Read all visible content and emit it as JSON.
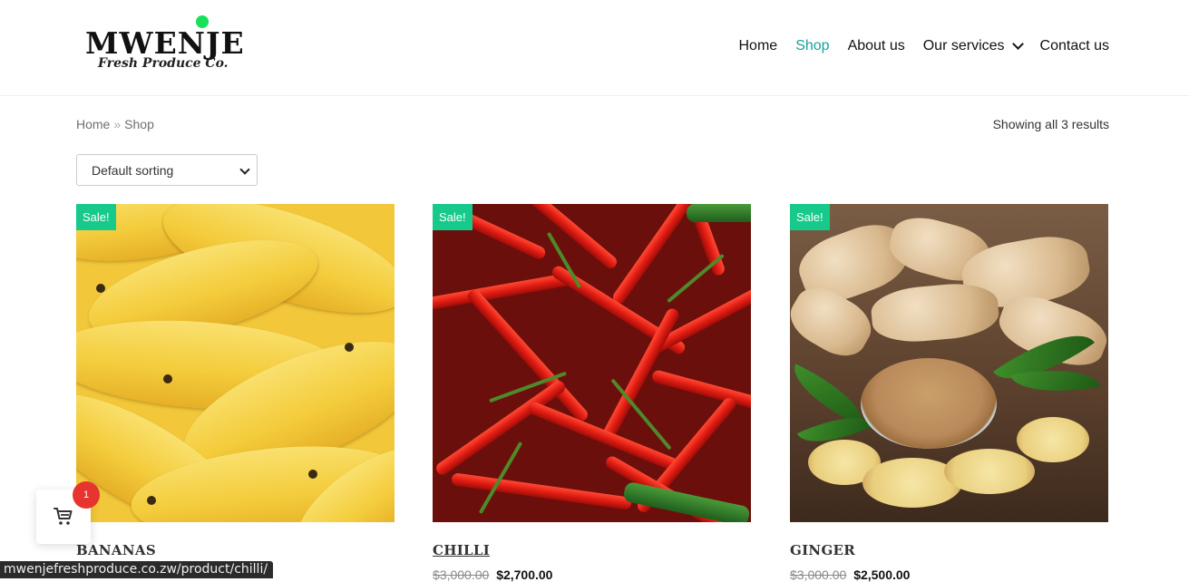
{
  "brand": {
    "name": "MWENJE",
    "tagline": "Fresh Produce Co."
  },
  "nav": [
    {
      "label": "Home",
      "active": false
    },
    {
      "label": "Shop",
      "active": true
    },
    {
      "label": "About us",
      "active": false
    },
    {
      "label": "Our services",
      "active": false,
      "has_dropdown": true
    },
    {
      "label": "Contact us",
      "active": false
    }
  ],
  "breadcrumb": {
    "home": "Home",
    "separator": "»",
    "current": "Shop"
  },
  "result_count": "Showing all 3 results",
  "sorting": {
    "selected": "Default sorting"
  },
  "products": [
    {
      "badge": "Sale!",
      "title": "BANANAS",
      "old_price": "",
      "price": ""
    },
    {
      "badge": "Sale!",
      "title": "CHILLI",
      "old_price": "$3,000.00",
      "price": "$2,700.00"
    },
    {
      "badge": "Sale!",
      "title": "GINGER",
      "old_price": "$3,000.00",
      "price": "$2,500.00"
    }
  ],
  "cart": {
    "count": "1"
  },
  "status_url": "mwenjefreshproduce.co.zw/product/chilli/",
  "colors": {
    "accent": "#17a19a",
    "sale_badge": "#17c98a",
    "cart_badge": "#e8342e",
    "logo_dot": "#17e05a"
  }
}
